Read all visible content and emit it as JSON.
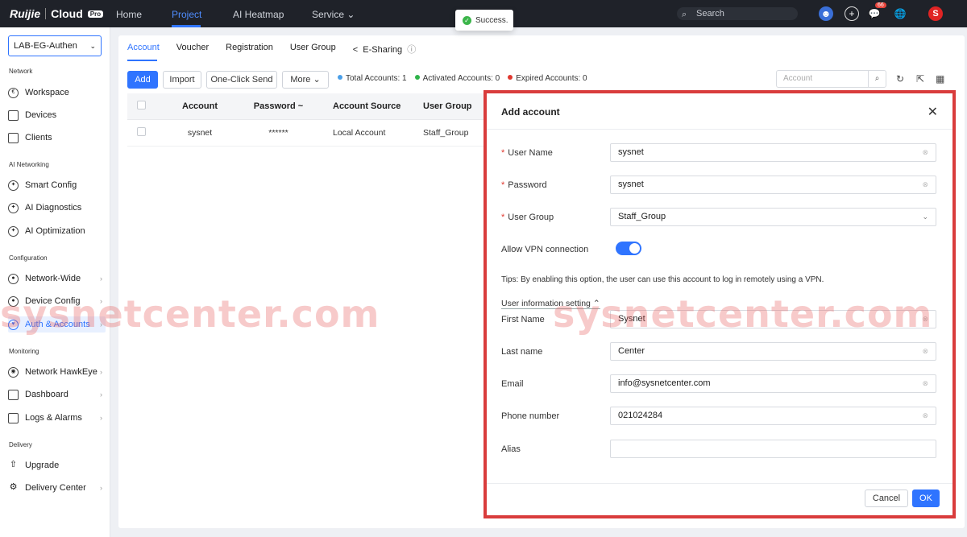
{
  "app": {
    "brand": "Ruijie",
    "product": "Cloud",
    "tier": "Pro"
  },
  "topnav": {
    "items": [
      "Home",
      "Project",
      "AI Heatmap",
      "Service"
    ],
    "search_label": "Search",
    "notification_count": "66",
    "avatar_letter": "S"
  },
  "toast": {
    "text": "Success."
  },
  "sidebar": {
    "project": "LAB-EG-Authen",
    "sections": {
      "network": "Network",
      "ai": "AI Networking",
      "config": "Configuration",
      "monitoring": "Monitoring",
      "delivery": "Delivery"
    },
    "items": {
      "workspace": "Workspace",
      "devices": "Devices",
      "clients": "Clients",
      "smart_config": "Smart Config",
      "ai_diagnostics": "AI Diagnostics",
      "ai_optimization": "AI Optimization",
      "network_wide": "Network-Wide",
      "device_config": "Device Config",
      "auth_accounts": "Auth & Accounts",
      "network_hawkeye": "Network HawkEye",
      "dashboard": "Dashboard",
      "logs_alarms": "Logs & Alarms",
      "upgrade": "Upgrade",
      "delivery_center": "Delivery Center"
    }
  },
  "main": {
    "tabs": [
      "Account",
      "Voucher",
      "Registration",
      "User Group",
      "E-Sharing"
    ],
    "buttons": {
      "add": "Add",
      "import": "Import",
      "one_click": "One-Click Send",
      "more": "More"
    },
    "stats": {
      "total_label": "Total Accounts: 1",
      "activated_label": "Activated Accounts: 0",
      "expired_label": "Expired Accounts: 0",
      "colors": {
        "total": "#4a9fe8",
        "activated": "#2fb34a",
        "expired": "#e0382f"
      }
    },
    "search_placeholder": "Account",
    "table": {
      "columns": [
        "Account",
        "Password",
        "Account Source",
        "User Group"
      ],
      "rows": [
        {
          "account": "sysnet",
          "password": "******",
          "source": "Local Account",
          "group": "Staff_Group"
        }
      ]
    }
  },
  "modal": {
    "title": "Add account",
    "fields": {
      "user_name": {
        "label": "User Name",
        "value": "sysnet"
      },
      "password": {
        "label": "Password",
        "value": "sysnet"
      },
      "user_group": {
        "label": "User Group",
        "value": "Staff_Group"
      },
      "vpn": {
        "label": "Allow VPN connection"
      },
      "tips": "Tips: By enabling this option, the user can use this account to log in remotely using a VPN.",
      "user_info_section": "User information setting",
      "first_name": {
        "label": "First Name",
        "value": "Sysnet"
      },
      "last_name": {
        "label": "Last name",
        "value": "Center"
      },
      "email": {
        "label": "Email",
        "value": "info@sysnetcenter.com"
      },
      "phone": {
        "label": "Phone number",
        "value": "021024284"
      },
      "alias": {
        "label": "Alias",
        "value": ""
      }
    },
    "vpn_enabled": true,
    "buttons": {
      "cancel": "Cancel",
      "ok": "OK"
    }
  },
  "watermark": "sysnetcenter.com",
  "colors": {
    "accent": "#2f74ff",
    "highlight_border": "#d93c3c",
    "topbar": "#1f2229"
  }
}
